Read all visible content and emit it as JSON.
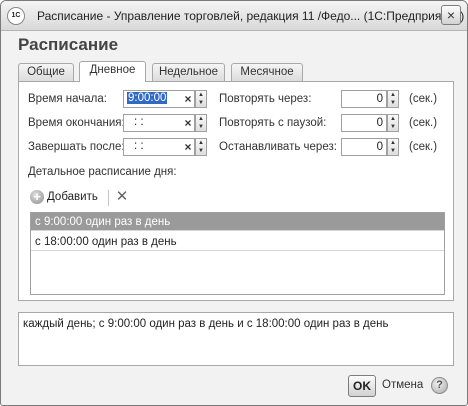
{
  "window": {
    "app_icon": "1С",
    "title": "Расписание - Управление торговлей, редакция 11 /Федо...  (1С:Предприятие)",
    "close_glyph": "×"
  },
  "page_title": "Расписание",
  "tabs": [
    {
      "label": "Общие",
      "active": false
    },
    {
      "label": "Дневное",
      "active": true
    },
    {
      "label": "Недельное",
      "active": false
    },
    {
      "label": "Месячное",
      "active": false
    }
  ],
  "form": {
    "start_time_label": "Время начала:",
    "start_time_value": "9:00:00",
    "end_time_label": "Время окончания:",
    "end_time_value": ": :",
    "finish_after_label": "Завершать после:",
    "finish_after_value": ": :",
    "repeat_every_label": "Повторять через:",
    "repeat_every_value": "0",
    "repeat_pause_label": "Повторять с паузой:",
    "repeat_pause_value": "0",
    "stop_after_label": "Останавливать через:",
    "stop_after_value": "0",
    "unit_label": "(сек.)",
    "detail_label": "Детальное расписание дня:",
    "clear_glyph": "×",
    "spin_up": "▲",
    "spin_down": "▼"
  },
  "toolbar": {
    "add_label": "Добавить",
    "add_glyph": "+",
    "delete_glyph": "✕"
  },
  "schedule_rows": [
    "с 9:00:00 один раз в день",
    "с 18:00:00 один раз в день"
  ],
  "summary": "каждый  день; с 9:00:00 один раз в день и с 18:00:00 один раз в день",
  "buttons": {
    "ok": "OK",
    "cancel": "Отмена",
    "help": "?"
  }
}
